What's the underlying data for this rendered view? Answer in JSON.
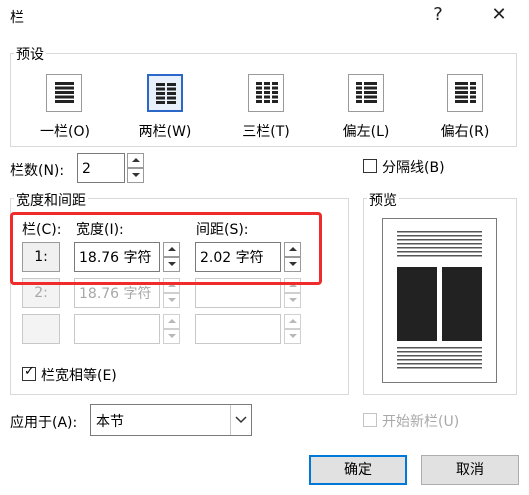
{
  "window": {
    "title": "栏",
    "help_label": "?",
    "close_label": "✕"
  },
  "presets": {
    "group_label": "预设",
    "items": [
      {
        "label": "一栏(O)",
        "icon": "one-column-icon"
      },
      {
        "label": "两栏(W)",
        "icon": "two-columns-icon",
        "selected": true
      },
      {
        "label": "三栏(T)",
        "icon": "three-columns-icon"
      },
      {
        "label": "偏左(L)",
        "icon": "left-column-icon"
      },
      {
        "label": "偏右(R)",
        "icon": "right-column-icon"
      }
    ]
  },
  "column_count": {
    "label": "栏数(N):",
    "value": "2"
  },
  "separator": {
    "label": "分隔线(B)",
    "checked": false
  },
  "width_spacing": {
    "group_label": "宽度和间距",
    "col_header": "栏(C):",
    "width_header": "宽度(I):",
    "spacing_header": "间距(S):",
    "rows": [
      {
        "col": "1:",
        "width": "18.76 字符",
        "spacing": "2.02 字符",
        "enabled": true
      },
      {
        "col": "2:",
        "width": "18.76 字符",
        "spacing": "",
        "enabled": false
      },
      {
        "col": "",
        "width": "",
        "spacing": "",
        "enabled": false
      }
    ],
    "equal_width": {
      "label": "栏宽相等(E)",
      "checked": true
    }
  },
  "preview": {
    "group_label": "预览"
  },
  "apply_to": {
    "label": "应用于(A):",
    "value": "本节"
  },
  "new_column": {
    "label": "开始新栏(U)",
    "checked": false,
    "enabled": false
  },
  "buttons": {
    "ok": "确定",
    "cancel": "取消"
  },
  "colors": {
    "accent": "#0078d7",
    "highlight": "#ef2b2b"
  }
}
